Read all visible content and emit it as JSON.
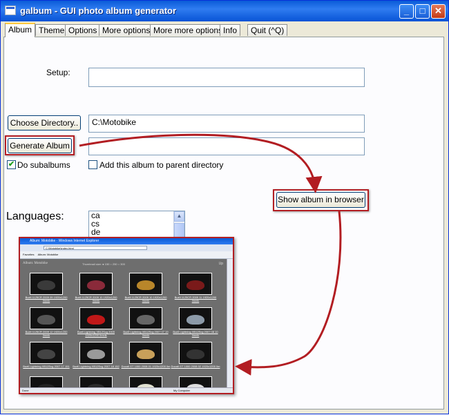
{
  "window": {
    "title": "galbum - GUI photo album generator",
    "minimize": "_",
    "maximize": "□",
    "close": "✕"
  },
  "tabs": [
    {
      "label": "Album",
      "active": true
    },
    {
      "label": "Theme"
    },
    {
      "label": "Options"
    },
    {
      "label": "More options"
    },
    {
      "label": "More more options"
    },
    {
      "label": "Info"
    },
    {
      "label": "Quit  (^Q)"
    }
  ],
  "album": {
    "setup_label": "Setup:",
    "setup_value": "",
    "choose_directory_button": "Choose Directory..",
    "directory_value": "C:\\Motobike",
    "generate_album_button": "Generate Album",
    "output_value": "",
    "do_subalbums_label": "Do subalbums",
    "do_subalbums_checked": true,
    "add_to_parent_label": "Add this album to parent directory",
    "add_to_parent_checked": false,
    "show_in_browser_button": "Show album in browser",
    "languages_label": "Languages:",
    "languages": [
      "ca",
      "cs",
      "de"
    ]
  },
  "browser_preview": {
    "window_title": "Album: Motobike - Windows Internet Explorer",
    "address": "C:\\Motobike\\index.html",
    "favorites": "Favorites",
    "favorite_item": "Album: Motobike",
    "album_title": "Album: Motobike",
    "thumbnail_size": "Thumbnail size:  ● 150  ○ 250  ○ 300",
    "up_link": "Up",
    "status": "Done",
    "status_right": "My Computer",
    "thumbnails": [
      {
        "caption": "Buell 1125CR 2009 09 1920x1200",
        "sub": "Ilmnik",
        "color": "#3a3a3a"
      },
      {
        "caption": "Buell 1125CR 2009 10 1920x1200",
        "sub": "Ilmnik",
        "color": "#8a2a3a"
      },
      {
        "caption": "Buell 1125CR 2009 10 1920x1200",
        "sub": "Ilmnik",
        "color": "#b8862a"
      },
      {
        "caption": "Buell 1125CR 2009 11 1920x1200",
        "sub": "Ilmnik",
        "color": "#7a1a1a"
      },
      {
        "caption": "Buell 1125CR 2009 12 1920x1200",
        "sub": "Ilmnik",
        "color": "#555555"
      },
      {
        "caption": "Buell Lightning XB12Scg 2009 1920x1200",
        "sub": "Ilmnik",
        "color": "#c01818"
      },
      {
        "caption": "Buell Lightning XB12Scg 2007 07 19",
        "sub": "Ilmnik",
        "color": "#666666"
      },
      {
        "caption": "Buell Lightning XB12Scg 2007 08 10",
        "sub": "Ilmnik",
        "color": "#8c9aa8"
      },
      {
        "caption": "Buell Lightning XB12Scg 2007 17 151",
        "sub": "",
        "color": "#444444"
      },
      {
        "caption": "Buell Lightning XB12Scg 2007 18 152",
        "sub": "",
        "color": "#9a9a9a"
      },
      {
        "caption": "Ducati GT 1000 2008 01 1920x1200",
        "sub": "Ilm",
        "color": "#c8a05a"
      },
      {
        "caption": "Ducati GT 1000 2008 02 1920x1200",
        "sub": "Ilm",
        "color": "#333333"
      },
      {
        "caption": "",
        "sub": "",
        "color": "#222222"
      },
      {
        "caption": "",
        "sub": "",
        "color": "#2a2a2a"
      },
      {
        "caption": "",
        "sub": "",
        "color": "#e0e0d0"
      },
      {
        "caption": "",
        "sub": "",
        "color": "#dddddd"
      }
    ]
  },
  "colors": {
    "highlight": "#b21d22",
    "titlebar": "#0a5bd8",
    "window_bg": "#ece9d8"
  }
}
